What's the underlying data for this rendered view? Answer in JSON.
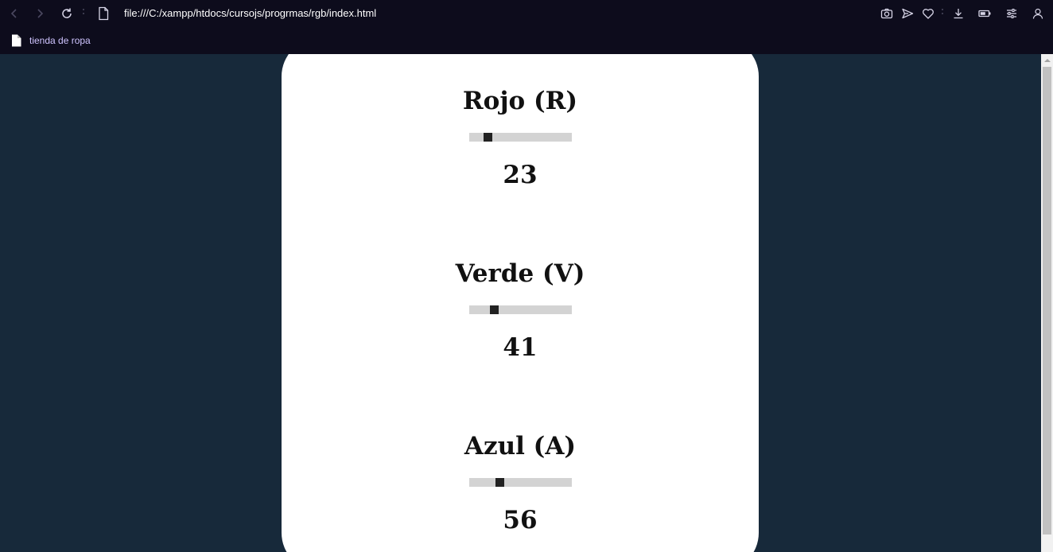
{
  "browser": {
    "url": "file:///C:/xampp/htdocs/cursojs/progrmas/rgb/index.html",
    "bookmarks": [
      {
        "label": "tienda de ropa"
      }
    ],
    "icons": [
      "back-icon",
      "forward-icon",
      "reload-icon",
      "page-icon",
      "camera-icon",
      "send-icon",
      "heart-icon",
      "download-icon",
      "battery-icon",
      "settings-icon",
      "profile-icon"
    ]
  },
  "sliders": [
    {
      "label": "Rojo (R)",
      "value": "23",
      "level": 23,
      "max": 255
    },
    {
      "label": "Verde (V)",
      "value": "41",
      "level": 41,
      "max": 255
    },
    {
      "label": "Azul (A)",
      "value": "56",
      "level": 56,
      "max": 255
    }
  ],
  "colors": {
    "background": "#17293a",
    "card": "#ffffff",
    "toolbar": "#0d0c1c",
    "track": "#d3d3d3",
    "thumb": "#222222"
  }
}
